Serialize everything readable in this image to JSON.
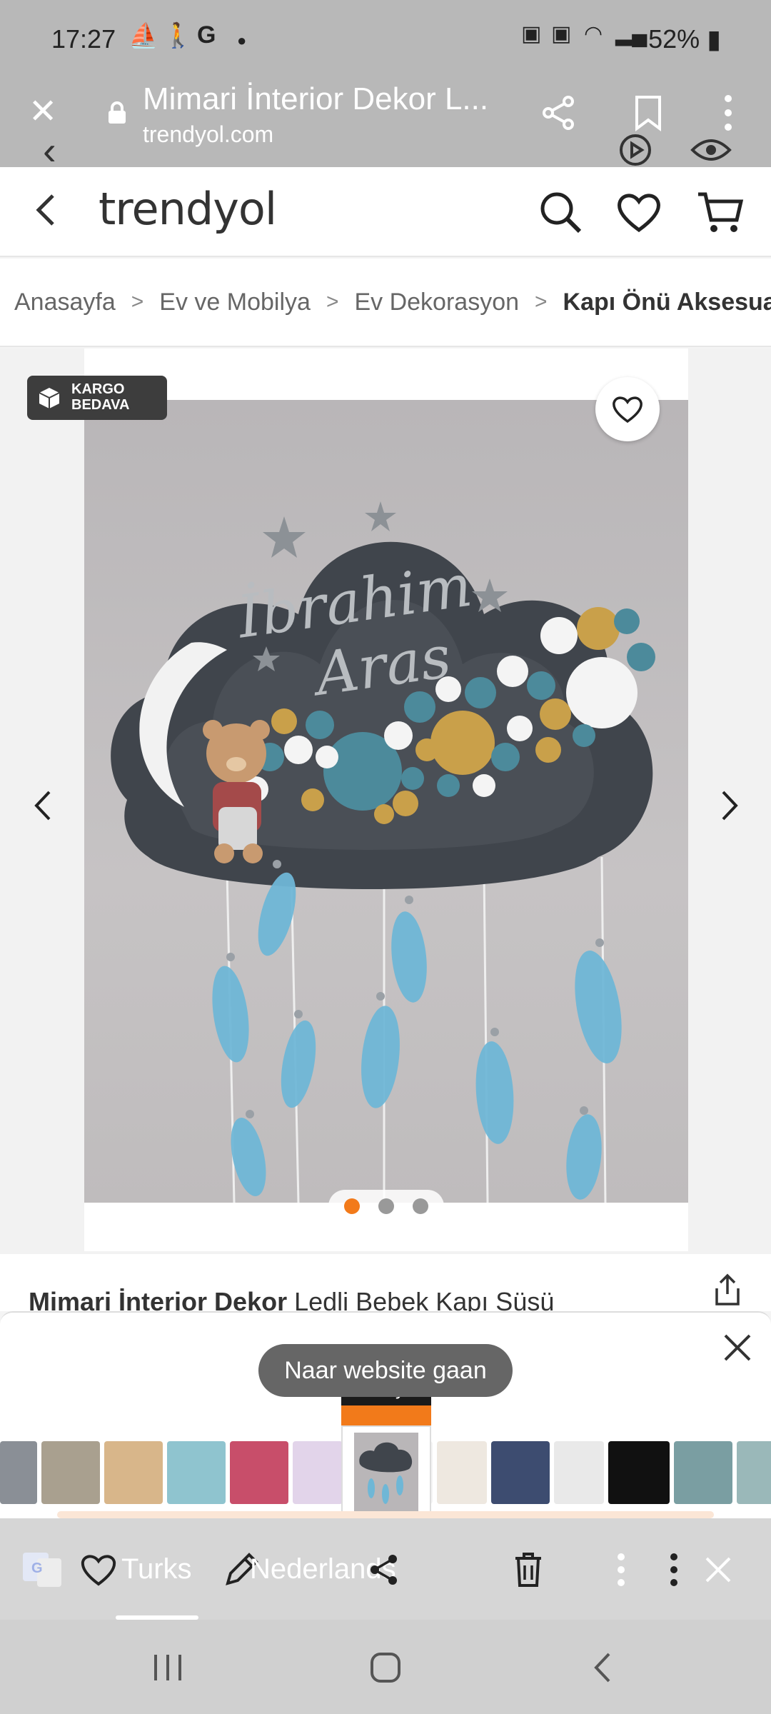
{
  "status_bar": {
    "time": "17:27",
    "battery": "52%"
  },
  "browser": {
    "page_title": "Mimari İnterior Dekor L...",
    "host": "trendyol.com"
  },
  "site": {
    "logo": "trendyol"
  },
  "breadcrumb": {
    "items": [
      "Anasayfa",
      "Ev ve Mobilya",
      "Ev Dekorasyon",
      "Kapı Önü Aksesuar"
    ]
  },
  "gallery": {
    "badge_line1": "KARGO",
    "badge_line2": "BEDAVA",
    "photo_text_line1": "İbrahim",
    "photo_text_line2": "Aras",
    "slide_index": 1,
    "slide_count": 3
  },
  "product": {
    "brand": "Mimari İnterior Dekor",
    "name": "Ledli Bebek Kapı Süsü"
  },
  "ad": {
    "button_label": "Naar website gaan",
    "logo": "trendyol"
  },
  "toolbar": {
    "source_language": "Turks",
    "target_language": "Nederlands"
  },
  "colors": {
    "accent": "#f27a1a",
    "chrome": "#b8b8b8"
  }
}
